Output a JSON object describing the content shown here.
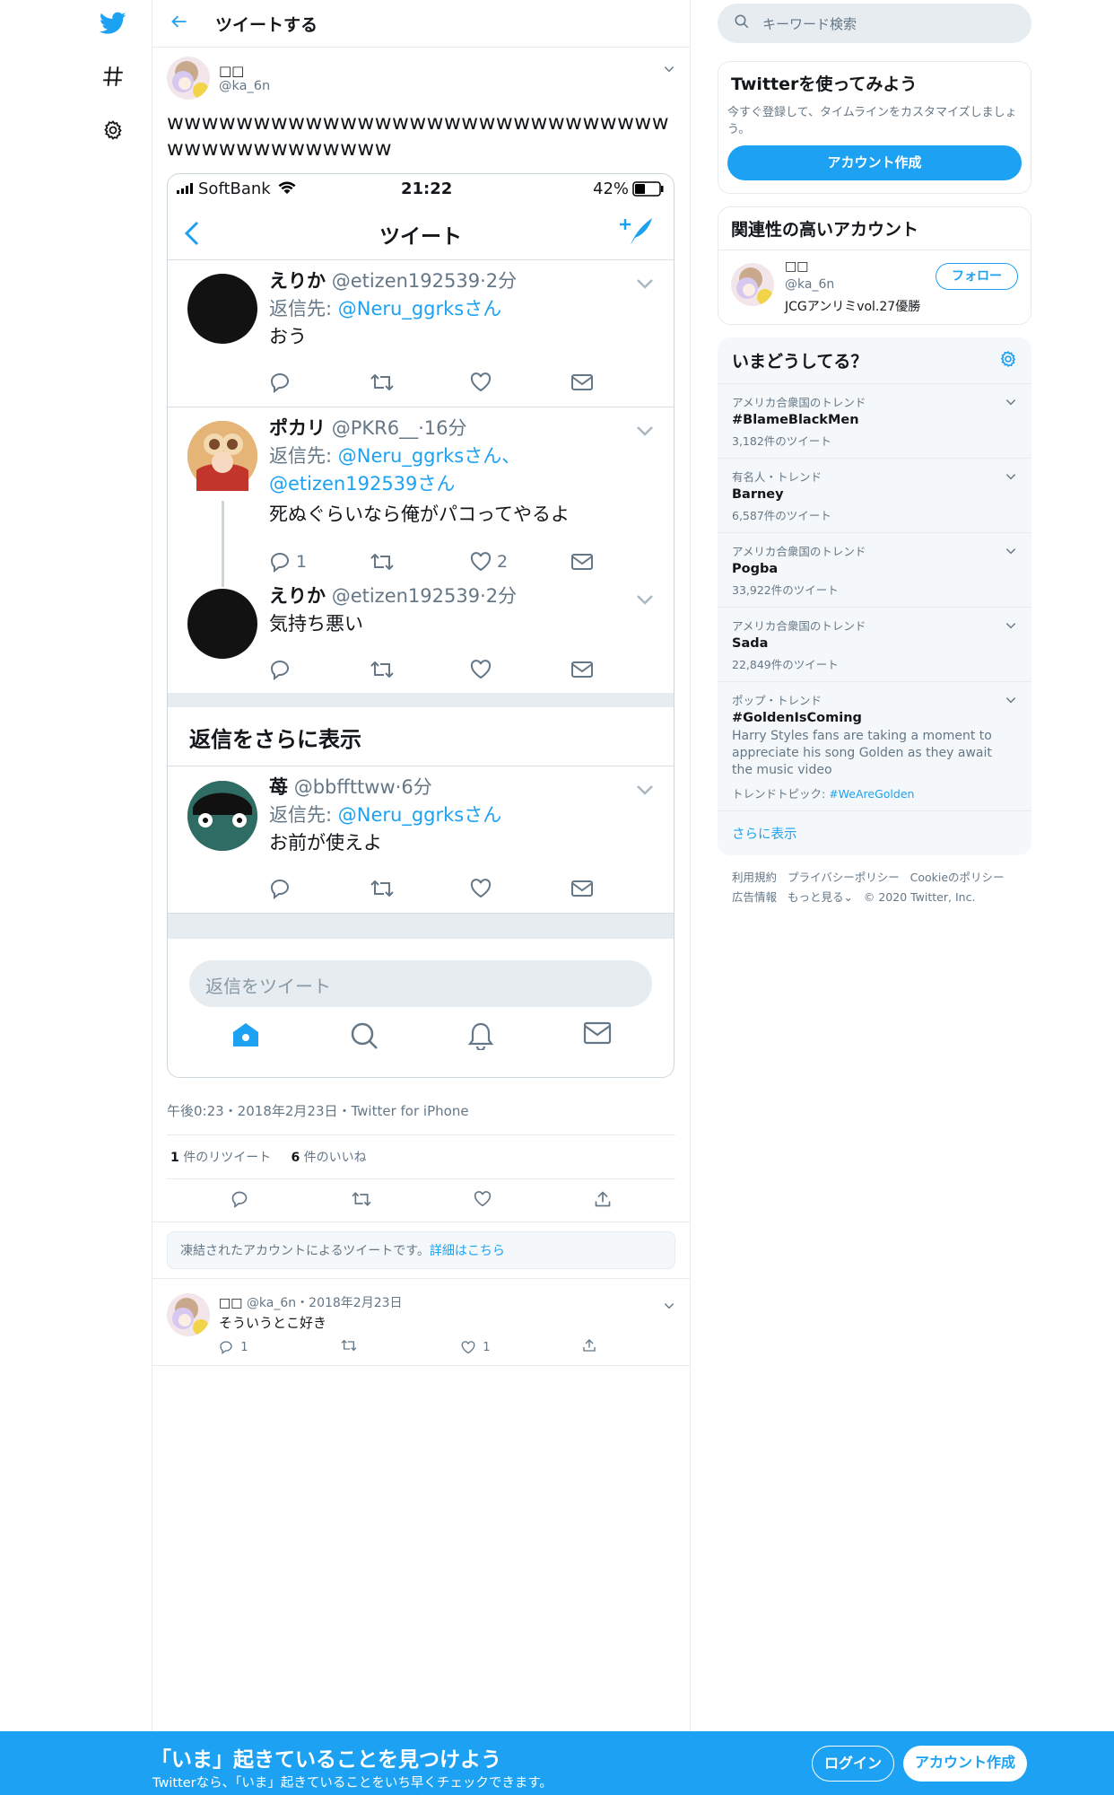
{
  "main": {
    "header_title": "ツイートする",
    "tweet": {
      "display_name": "□□",
      "handle": "@ka_6n",
      "text": "wwwwwwwwwwwwwwwwwwwwwwwwwwwwwwwwwwwwwwwwww",
      "meta": "午後0:23・2018年2月23日・Twitter for iPhone",
      "retweets_count": "1",
      "retweets_label": "件のリツイート",
      "likes_count": "6",
      "likes_label": "件のいいね"
    },
    "notice": {
      "text": "凍結されたアカウントによるツイートです。",
      "link": "詳細はこちら"
    },
    "reply": {
      "display_name": "□□",
      "handle": "@ka_6n",
      "date": "2018年2月23日",
      "text": "そういうとこ好き",
      "replies": "1",
      "likes": "1"
    }
  },
  "screenshot": {
    "carrier": "SoftBank",
    "time": "21:22",
    "battery": "42%",
    "title": "ツイート",
    "tweets": [
      {
        "name": "えりか",
        "handle": "@etizen192539",
        "time": "2分",
        "reply_prefix": "返信先: ",
        "reply_to": "@Neru_ggrksさん",
        "text": "おう"
      },
      {
        "name": "ポカリ",
        "handle": "@PKR6__",
        "time": "16分",
        "reply_prefix": "返信先: ",
        "reply_to": "@Neru_ggrksさん、",
        "reply_to2": "@etizen192539さん",
        "text": "死ぬぐらいなら俺がパコってやるよ",
        "replies": "1",
        "likes": "2"
      },
      {
        "name": "えりか",
        "handle": "@etizen192539",
        "time": "2分",
        "text": "気持ち悪い"
      },
      {
        "name": "苺",
        "handle": "@bbffttww",
        "time": "6分",
        "reply_prefix": "返信先: ",
        "reply_to": "@Neru_ggrksさん",
        "text": "お前が使えよ"
      }
    ],
    "more_replies": "返信をさらに表示",
    "reply_placeholder": "返信をツイート"
  },
  "sidebar": {
    "search_placeholder": "キーワード検索",
    "signup_card": {
      "title": "Twitterを使ってみよう",
      "desc": "今すぐ登録して、タイムラインをカスタマイズしましょう。",
      "button": "アカウント作成"
    },
    "related": {
      "title": "関連性の高いアカウント",
      "name": "□□",
      "handle": "@ka_6n",
      "bio": "JCGアンリミvol.27優勝",
      "follow": "フォロー"
    },
    "trends": {
      "title": "いまどうしてる？",
      "items": [
        {
          "category": "アメリカ合衆国のトレンド",
          "name": "#BlameBlackMen",
          "count": "3,182件のツイート"
        },
        {
          "category": "有名人・トレンド",
          "name": "Barney",
          "count": "6,587件のツイート"
        },
        {
          "category": "アメリカ合衆国のトレンド",
          "name": "Pogba",
          "count": "33,922件のツイート"
        },
        {
          "category": "アメリカ合衆国のトレンド",
          "name": "Sada",
          "count": "22,849件のツイート"
        },
        {
          "category": "ポップ・トレンド",
          "name": "#GoldenIsComing",
          "desc": "Harry Styles fans are taking a moment to appreciate his song Golden as they await the music video",
          "topic_label": "トレンドトピック: ",
          "topic": "#WeAreGolden"
        }
      ],
      "show_more": "さらに表示"
    },
    "footer": {
      "terms": "利用規約",
      "privacy": "プライバシーポリシー",
      "cookie": "Cookieのポリシー",
      "ads": "広告情報",
      "more": "もっと見る",
      "copyright": "© 2020 Twitter, Inc."
    }
  },
  "bottom_bar": {
    "headline": "「いま」起きていることを見つけよう",
    "sub": "Twitterなら、「いま」起きていることをいち早くチェックできます。",
    "login": "ログイン",
    "signup": "アカウント作成"
  },
  "colors": {
    "accent": "#1da1f2",
    "secondary_text": "#657786",
    "border": "#e6ecf0"
  }
}
